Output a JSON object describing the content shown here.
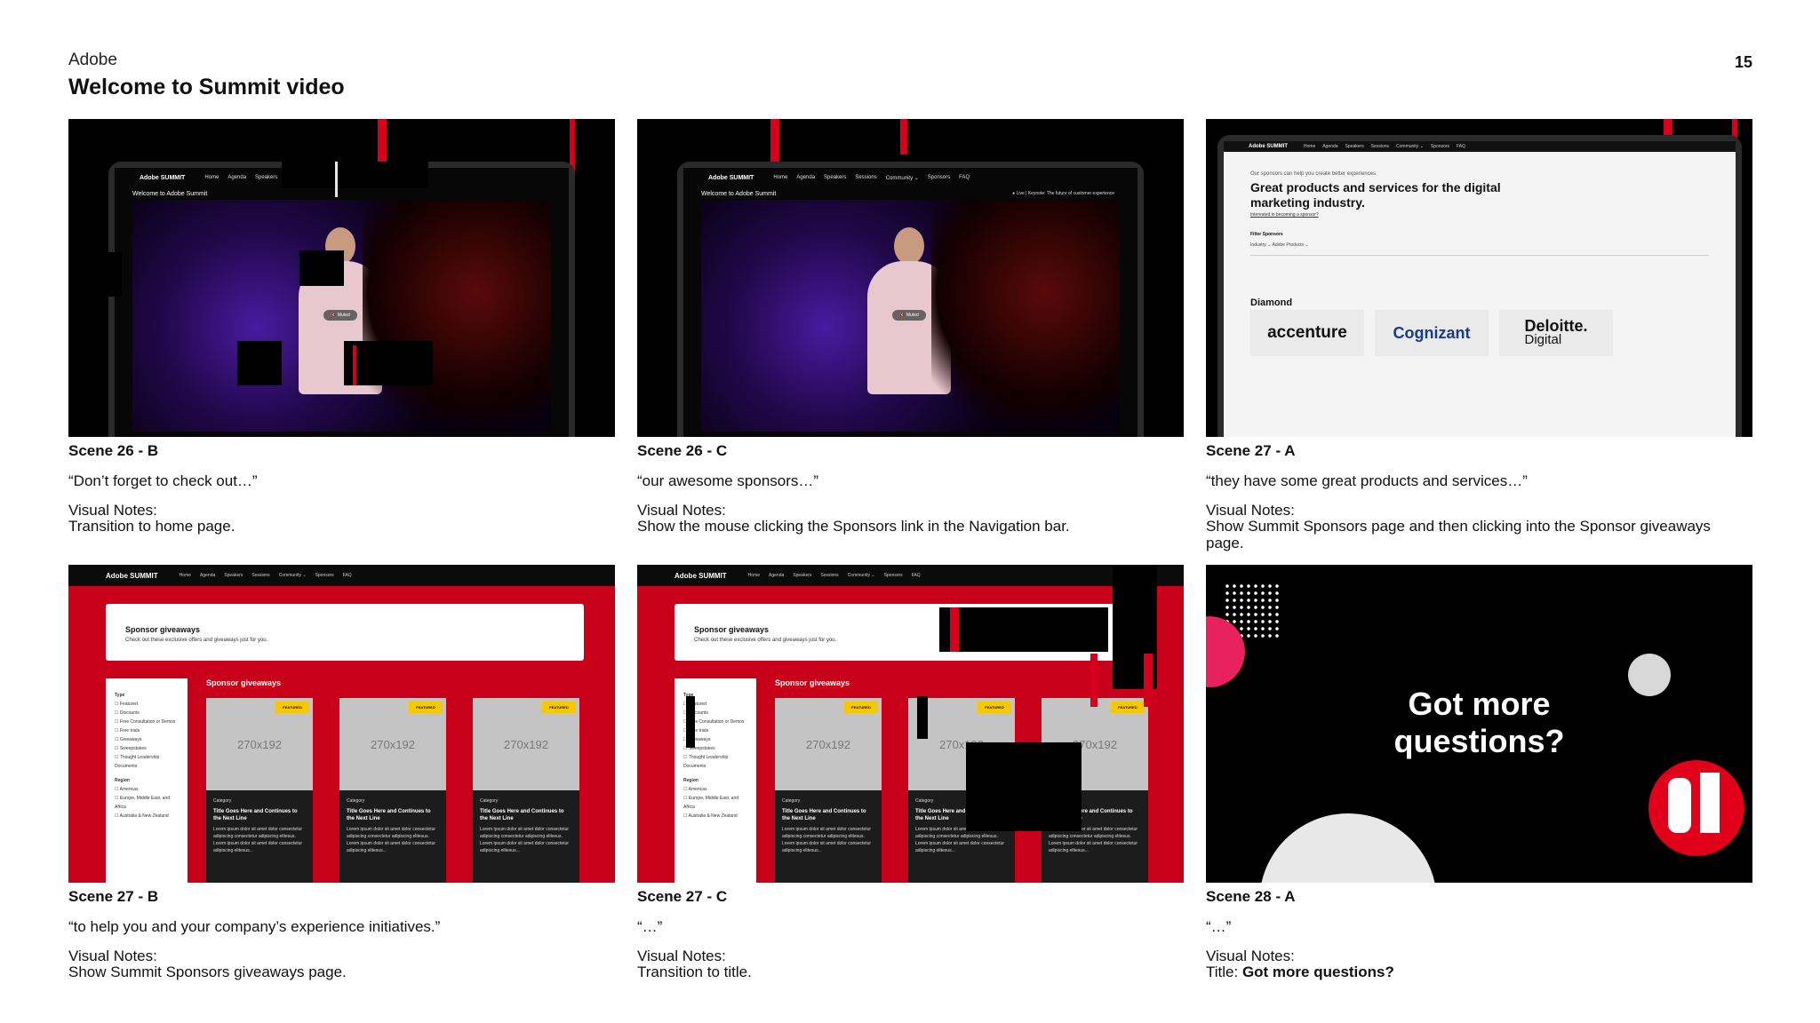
{
  "header": {
    "brand": "Adobe",
    "title": "Welcome to Summit video",
    "page_number": "15"
  },
  "scenes": [
    {
      "label": "Scene 26 - B",
      "quote": "“Don’t forget to check out…”",
      "notes_heading": "Visual Notes:",
      "notes": "Transition to home page."
    },
    {
      "label": "Scene 26 - C",
      "quote": "“our awesome sponsors…”",
      "notes_heading": "Visual Notes:",
      "notes": "Show the mouse clicking the Sponsors link in the Navigation bar."
    },
    {
      "label": "Scene 27 - A",
      "quote": "“they have some great products and services…”",
      "notes_heading": "Visual Notes:",
      "notes": "Show Summit Sponsors page and then clicking into the Sponsor giveaways page."
    },
    {
      "label": "Scene 27 - B",
      "quote": "“to help you and your company’s experience initiatives.”",
      "notes_heading": "Visual Notes:",
      "notes": "Show Summit Sponsors giveaways page."
    },
    {
      "label": "Scene 27 - C",
      "quote": "“…”",
      "notes_heading": "Visual Notes:",
      "notes": "Transition to title."
    },
    {
      "label": "Scene 28 - A",
      "quote": "“…”",
      "notes_heading": "Visual Notes:",
      "notes_prefix": "Title: ",
      "notes_bold": "Got more questions?"
    }
  ],
  "site": {
    "logo": "Adobe SUMMIT",
    "nav": [
      "Home",
      "Agenda",
      "Speakers",
      "Sessions",
      "Community ⌄",
      "Sponsors",
      "FAQ"
    ],
    "welcome": "Welcome to Adobe Summit",
    "live": "● Live | Keynote: The future of customer experience",
    "muted": "🔇 Muted"
  },
  "sponsors_page": {
    "eyebrow": "Our sponsors can help you create better experiences",
    "headline": "Great products and services for the digital marketing industry.",
    "link": "Interested in becoming a sponsor?",
    "filter": "Filter Sponsors",
    "dropdowns": "Industry ⌄     Adobe Products ⌄",
    "tier": "Diamond",
    "logos": [
      "accenture",
      "Cognizant",
      "Deloitte.",
      "Digital"
    ]
  },
  "giveaways": {
    "heading": "Sponsor giveaways",
    "subheading": "Check out these exclusive offers and giveaways just for you.",
    "section_label": "Sponsor giveaways",
    "filters_type": "Type",
    "filters": [
      "Featured",
      "Discounts",
      "Free Consultation or Demos",
      "Free trials",
      "Giveaways",
      "Sweepstakes",
      "Thought Leadership Documents"
    ],
    "filters_region": "Region",
    "regions": [
      "Americas",
      "Europe, Middle East, and Africa",
      "Australia & New Zealand"
    ],
    "card_badge": "FEATURED",
    "card_image": "270x192",
    "card_category": "Category",
    "card_title": "Title Goes Here and Continues to the Next Line",
    "card_body": "Lorem ipsum dolor sit amet dolor consectetur adipiscing consectetur adipiscing elitesus. Lorem ipsum dolor sit amet dolor consectetur adipiscing elitesus..."
  },
  "title_frame": {
    "line1": "Got more",
    "line2": "questions?"
  }
}
